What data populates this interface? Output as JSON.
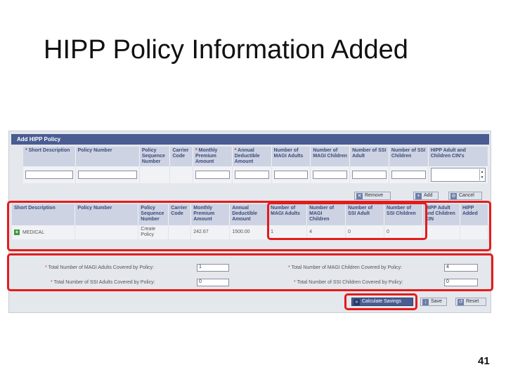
{
  "slide": {
    "title": "HIPP Policy Information Added",
    "page_number": "41",
    "accent_colors": [
      "#f15a24",
      "#f4a582",
      "#3a7abd",
      "#d9e6f2"
    ]
  },
  "panel": {
    "header": "Add HIPP Policy"
  },
  "add_form": {
    "columns": [
      {
        "req": "*",
        "label": "Short Description"
      },
      {
        "req": "",
        "label": "Policy Number"
      },
      {
        "req": "",
        "label": "Policy Sequence Number"
      },
      {
        "req": "",
        "label": "Carrier Code"
      },
      {
        "req": "*",
        "label": "Monthly Premium Amount"
      },
      {
        "req": "*",
        "label": "Annual Deductible Amount"
      },
      {
        "req": "",
        "label": "Number of MAGI Adults"
      },
      {
        "req": "",
        "label": "Number of MAGI Children"
      },
      {
        "req": "",
        "label": "Number of SSI Adult"
      },
      {
        "req": "",
        "label": "Number of SSI Children"
      },
      {
        "req": "",
        "label": "HIPP Adult and Children CIN's"
      }
    ],
    "buttons": {
      "remove": "Remove",
      "add": "Add",
      "cancel": "Cancel"
    }
  },
  "policy_table": {
    "columns": [
      "Short Description",
      "Policy Number",
      "Policy Sequence Number",
      "Carrier Code",
      "Monthly Premium Amount",
      "Annual Deductible Amount",
      "Number of MAGI Adults",
      "Number of MAGI Children",
      "Number of SSI Adult",
      "Number of SSI Children",
      "HIPP Adult and Children CIN",
      "HIPP Added"
    ],
    "rows": [
      {
        "short_description": "MEDICAL",
        "policy_number": "",
        "sequence": "Create Policy",
        "carrier": "",
        "premium": "242.67",
        "deductible": "1500.00",
        "magi_adults": "1",
        "magi_children": "4",
        "ssi_adult": "0",
        "ssi_children": "0",
        "cin": "",
        "hipp_added": ""
      }
    ]
  },
  "totals": {
    "magi_adults_label": "Total Number of MAGI Adults Covered by Policy:",
    "magi_adults_value": "1",
    "magi_children_label": "Total Number of MAGI Children Covered by Policy:",
    "magi_children_value": "4",
    "ssi_adults_label": "Total Number of SSI Adults Covered by Policy:",
    "ssi_adults_value": "0",
    "ssi_children_label": "Total Number of SSI Children Covered by Policy:",
    "ssi_children_value": "0",
    "req": "*"
  },
  "actions": {
    "calculate": "Calculate Savings",
    "save": "Save",
    "reset": "Reset"
  }
}
